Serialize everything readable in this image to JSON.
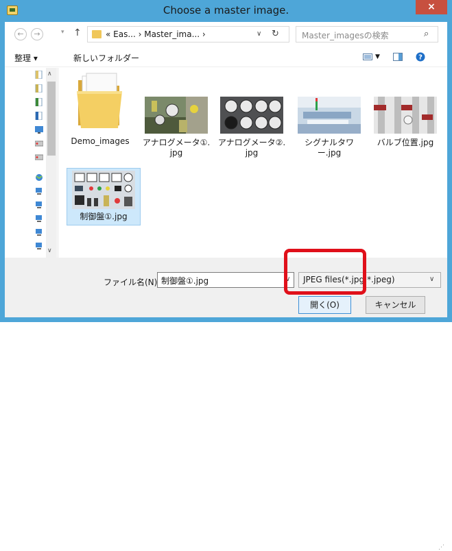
{
  "window": {
    "title": "Choose a master image.",
    "close_glyph": "×"
  },
  "nav": {
    "back_glyph": "←",
    "forward_glyph": "→",
    "up_glyph": "↑",
    "breadcrumbs": "« Eas... › Master_ima... ›",
    "refresh_glyph": "↻",
    "search_placeholder": "Master_imagesの検索"
  },
  "toolbar": {
    "organize_label": "整理 ▾",
    "new_folder_label": "新しいフォルダー"
  },
  "files": [
    {
      "name": "Demo_images",
      "kind": "folder"
    },
    {
      "name": "アナログメータ①.\njpg",
      "kind": "image"
    },
    {
      "name": "アナログメータ②.\njpg",
      "kind": "image"
    },
    {
      "name": "シグナルタワー.jpg",
      "kind": "image"
    },
    {
      "name": "バルブ位置.jpg",
      "kind": "image"
    },
    {
      "name": "制御盤①.jpg",
      "kind": "image",
      "selected": true
    }
  ],
  "footer": {
    "filename_label": "ファイル名(N):",
    "filename_value": "制御盤①.jpg",
    "filetype_value": "JPEG files(*.jpg;*.jpeg)",
    "open_label": "開く(O)",
    "cancel_label": "キャンセル"
  },
  "colors": {
    "title_bar": "#4ea6d8",
    "close_button": "#c7503f",
    "selection": "#cde8fb",
    "highlight_box": "#e0101a"
  }
}
